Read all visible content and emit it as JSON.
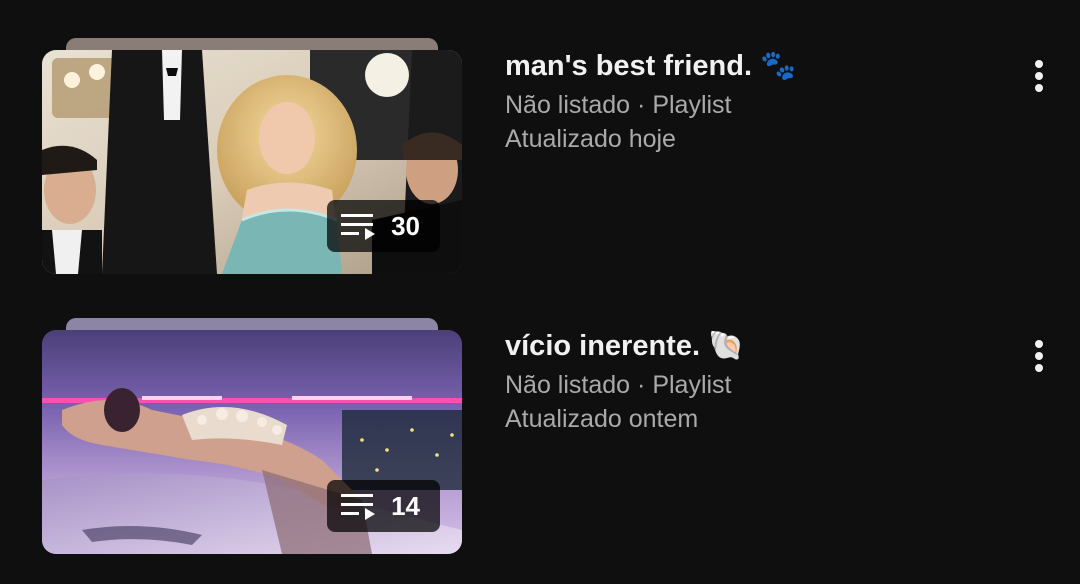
{
  "playlists": [
    {
      "title": "man's best friend. 🐾",
      "visibility": "Não listado",
      "separator": "·",
      "type": "Playlist",
      "updated": "Atualizado hoje",
      "video_count": "30",
      "stack_color": "#8a7d78",
      "thumbnail_icon": "party-photo-thumbnail"
    },
    {
      "title": "vício inerente. 🐚",
      "visibility": "Não listado",
      "separator": "·",
      "type": "Playlist",
      "updated": "Atualizado ontem",
      "video_count": "14",
      "stack_color": "#8d85a6",
      "thumbnail_icon": "neon-car-photo-thumbnail"
    }
  ],
  "icons": {
    "badge": "playlist-queue-icon",
    "menu": "more-vertical-icon"
  }
}
